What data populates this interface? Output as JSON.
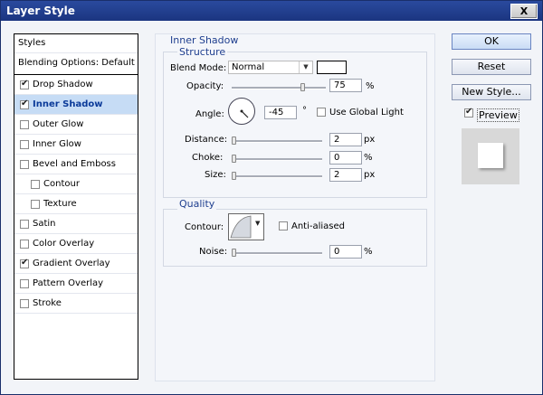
{
  "window": {
    "title": "Layer Style",
    "close_label": "X"
  },
  "styles_list": {
    "header": "Styles",
    "blending": "Blending Options: Default",
    "items": [
      {
        "label": "Drop Shadow",
        "checked": true,
        "selected": false,
        "indent": false
      },
      {
        "label": "Inner Shadow",
        "checked": true,
        "selected": true,
        "indent": false
      },
      {
        "label": "Outer Glow",
        "checked": false,
        "selected": false,
        "indent": false
      },
      {
        "label": "Inner Glow",
        "checked": false,
        "selected": false,
        "indent": false
      },
      {
        "label": "Bevel and Emboss",
        "checked": false,
        "selected": false,
        "indent": false
      },
      {
        "label": "Contour",
        "checked": false,
        "selected": false,
        "indent": true
      },
      {
        "label": "Texture",
        "checked": false,
        "selected": false,
        "indent": true
      },
      {
        "label": "Satin",
        "checked": false,
        "selected": false,
        "indent": false
      },
      {
        "label": "Color Overlay",
        "checked": false,
        "selected": false,
        "indent": false
      },
      {
        "label": "Gradient Overlay",
        "checked": true,
        "selected": false,
        "indent": false
      },
      {
        "label": "Pattern Overlay",
        "checked": false,
        "selected": false,
        "indent": false
      },
      {
        "label": "Stroke",
        "checked": false,
        "selected": false,
        "indent": false
      }
    ]
  },
  "inner_shadow": {
    "title": "Inner Shadow",
    "structure_title": "Structure",
    "blend_mode_label": "Blend Mode:",
    "blend_mode_value": "Normal",
    "opacity_label": "Opacity:",
    "opacity_value": "75",
    "opacity_unit": "%",
    "opacity_level": 0.75,
    "angle_label": "Angle:",
    "angle_value": "-45",
    "angle_unit": "°",
    "use_global_light_label": "Use Global Light",
    "distance_label": "Distance:",
    "distance_value": "2",
    "distance_unit": "px",
    "choke_label": "Choke:",
    "choke_value": "0",
    "choke_unit": "%",
    "size_label": "Size:",
    "size_value": "2",
    "size_unit": "px"
  },
  "quality": {
    "title": "Quality",
    "contour_label": "Contour:",
    "anti_aliased_label": "Anti-aliased",
    "noise_label": "Noise:",
    "noise_value": "0",
    "noise_unit": "%"
  },
  "buttons": {
    "ok": "OK",
    "reset": "Reset",
    "new_style": "New Style...",
    "preview": "Preview"
  },
  "colors": {
    "accent": "#1f3f8f",
    "selection": "#c6dcf5",
    "titlebar": "#1b3580"
  }
}
